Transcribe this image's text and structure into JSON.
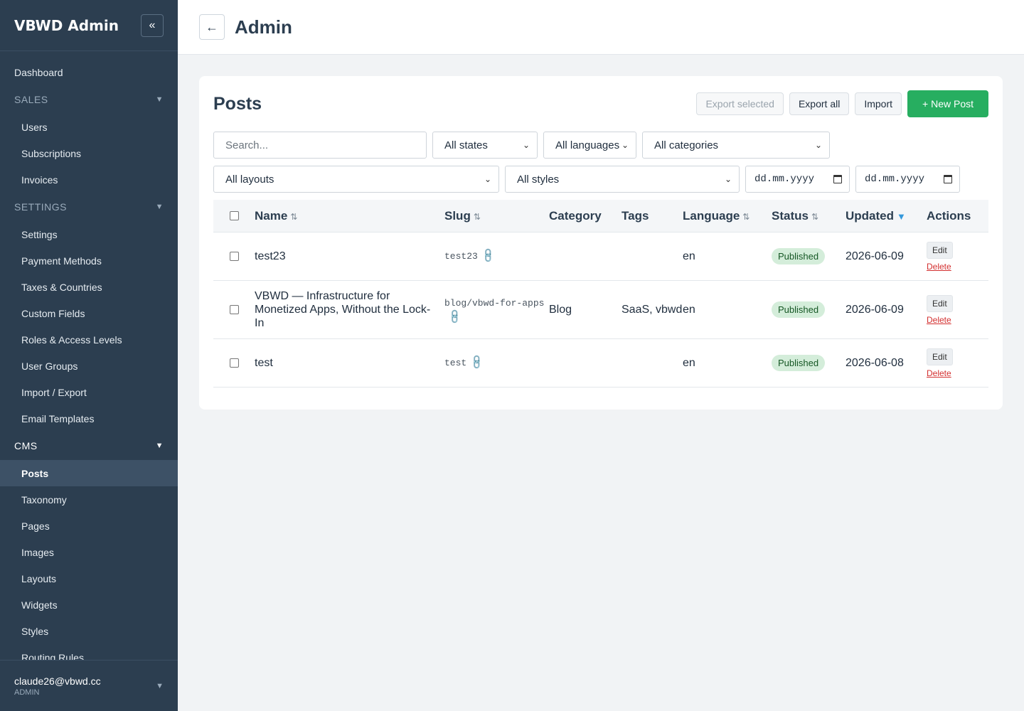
{
  "sidebar": {
    "brand": "VBWD Admin",
    "collapse_icon": "«",
    "dashboard": "Dashboard",
    "sales": {
      "label": "SALES",
      "items": [
        "Users",
        "Subscriptions",
        "Invoices"
      ]
    },
    "settings": {
      "label": "SETTINGS",
      "items": [
        "Settings",
        "Payment Methods",
        "Taxes & Countries",
        "Custom Fields",
        "Roles & Access Levels",
        "User Groups",
        "Import / Export",
        "Email Templates"
      ]
    },
    "cms": {
      "label": "CMS",
      "items": [
        "Posts",
        "Taxonomy",
        "Pages",
        "Images",
        "Layouts",
        "Widgets",
        "Styles",
        "Routing Rules"
      ],
      "active": "Posts"
    },
    "caret": "▼",
    "user": {
      "email": "claude26@vbwd.cc",
      "role": "ADMIN"
    }
  },
  "header": {
    "back_icon": "←",
    "title": "Admin"
  },
  "posts": {
    "title": "Posts",
    "buttons": {
      "export_selected": "Export selected",
      "export_all": "Export all",
      "import": "Import",
      "new_post": "+ New Post"
    },
    "filters": {
      "search_placeholder": "Search...",
      "states": "All states",
      "languages": "All languages",
      "categories": "All categories",
      "layouts": "All layouts",
      "styles": "All styles",
      "date_from": "dd.mm.yyyy",
      "date_to": "dd.mm.yyyy"
    },
    "columns": {
      "name": "Name",
      "slug": "Slug",
      "category": "Category",
      "tags": "Tags",
      "language": "Language",
      "status": "Status",
      "updated": "Updated",
      "actions": "Actions"
    },
    "sort_icon": "⇅",
    "sort_active_icon": "▼",
    "link_icon": "🔗",
    "edit_label": "Edit",
    "delete_label": "Delete",
    "rows": [
      {
        "name": "test23",
        "slug": "test23",
        "category": "",
        "tags": "",
        "language": "en",
        "status": "Published",
        "updated": "2026-06-09"
      },
      {
        "name": "VBWD — Infrastructure for Monetized Apps, Without the Lock-In",
        "slug": "blog/vbwd-for-apps",
        "category": "Blog",
        "tags": "SaaS, vbwd",
        "language": "en",
        "status": "Published",
        "updated": "2026-06-09"
      },
      {
        "name": "test",
        "slug": "test",
        "category": "",
        "tags": "",
        "language": "en",
        "status": "Published",
        "updated": "2026-06-08"
      }
    ]
  }
}
